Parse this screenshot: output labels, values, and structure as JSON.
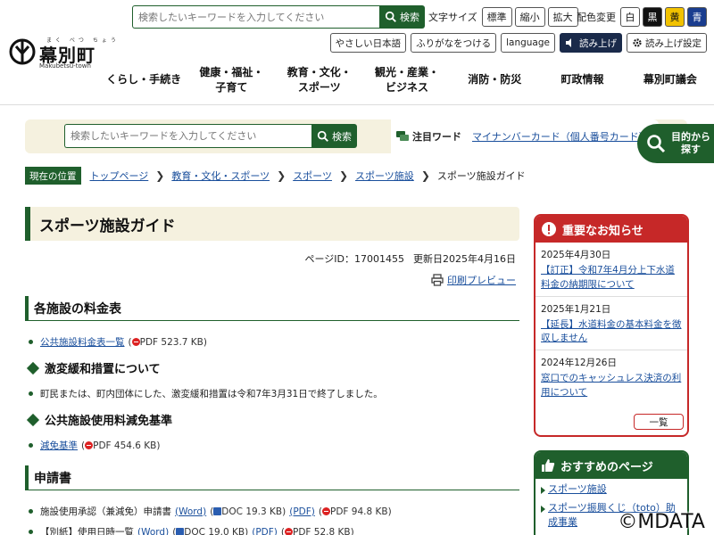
{
  "header": {
    "logo_ruby": "まく べつ ちょう",
    "logo_text": "幕別町",
    "logo_sub": "Makubetsu-town",
    "search_placeholder": "検索したいキーワードを入力してください",
    "search_button": "検索",
    "text_size_label": "文字サイズ",
    "text_size_options": [
      "標準",
      "縮小",
      "拡大"
    ],
    "color_label": "配色変更",
    "color_options": [
      {
        "label": "白",
        "bg": "#ffffff",
        "fg": "#222222"
      },
      {
        "label": "黒",
        "bg": "#111111",
        "fg": "#ffffff"
      },
      {
        "label": "黄",
        "bg": "#f2c200",
        "fg": "#111111"
      },
      {
        "label": "青",
        "bg": "#1a3d8f",
        "fg": "#ffffff"
      }
    ],
    "easy_japanese": "やさしい日本語",
    "furigana": "ふりがなをつける",
    "language": "language",
    "read_aloud": "読み上げ",
    "read_settings": "読み上げ設定"
  },
  "nav": [
    {
      "line1": "くらし・手続き",
      "line2": ""
    },
    {
      "line1": "健康・福祉・",
      "line2": "子育て"
    },
    {
      "line1": "教育・文化・",
      "line2": "スポーツ"
    },
    {
      "line1": "観光・産業・",
      "line2": "ビジネス"
    },
    {
      "line1": "消防・防災",
      "line2": ""
    },
    {
      "line1": "町政情報",
      "line2": ""
    },
    {
      "line1": "幕別町議会",
      "line2": ""
    }
  ],
  "band": {
    "search_placeholder": "検索したいキーワードを入力してください",
    "search_button": "検索",
    "attention_label": "注目ワード",
    "attention_link": "マイナンバーカード（個人番号カード）",
    "purpose_line1": "目的から",
    "purpose_line2": "探す"
  },
  "breadcrumb": {
    "current_label": "現在の位置",
    "items": [
      "トップページ",
      "教育・文化・スポーツ",
      "スポーツ",
      "スポーツ施設"
    ],
    "last": "スポーツ施設ガイド"
  },
  "main": {
    "title": "スポーツ施設ガイド",
    "page_id": "ページID：17001455",
    "updated": "更新日2025年4月16日",
    "print": "印刷プレビュー",
    "sec1_title": "各施設の料金表",
    "sec1_link": "公共施設料金表一覧",
    "sec1_link_meta": "PDF 523.7 KB)",
    "h3_1": "激変緩和措置について",
    "h3_1_text": "町民または、町内団体にした、激変緩和措置は令和7年3月31日で終了しました。",
    "h3_2": "公共施設使用料減免基準",
    "h3_2_link": "減免基準",
    "h3_2_meta": "PDF 454.6 KB)",
    "sec2_title": "申請書",
    "app1_text": "施設使用承認（兼減免）申請書",
    "app1_word": "(Word)",
    "app1_word_meta": "DOC 19.3 KB)",
    "app1_pdf": "(PDF)",
    "app1_pdf_meta": "PDF 94.8 KB)",
    "app2_text": "【別紙】使用日時一覧",
    "app2_word": "(Word)",
    "app2_word_meta": "DOC 19.0 KB)",
    "app2_pdf": "(PDF)",
    "app2_pdf_meta": "PDF 52.8 KB)",
    "open_paren": "("
  },
  "notice": {
    "title": "重要なお知らせ",
    "items": [
      {
        "date": "2025年4月30日",
        "text": "【訂正】令和7年4月分上下水道料金の納期限について"
      },
      {
        "date": "2025年1月21日",
        "text": "【延長】水道料金の基本料金を徴収しません"
      },
      {
        "date": "2024年12月26日",
        "text": "窓口でのキャッシュレス決済の利用について"
      }
    ],
    "list_button": "一覧"
  },
  "reco": {
    "title": "おすすめのページ",
    "items": [
      "スポーツ施設",
      "スポーツ振興くじ（toto）助成事業"
    ]
  },
  "watermark": "©MDATA"
}
